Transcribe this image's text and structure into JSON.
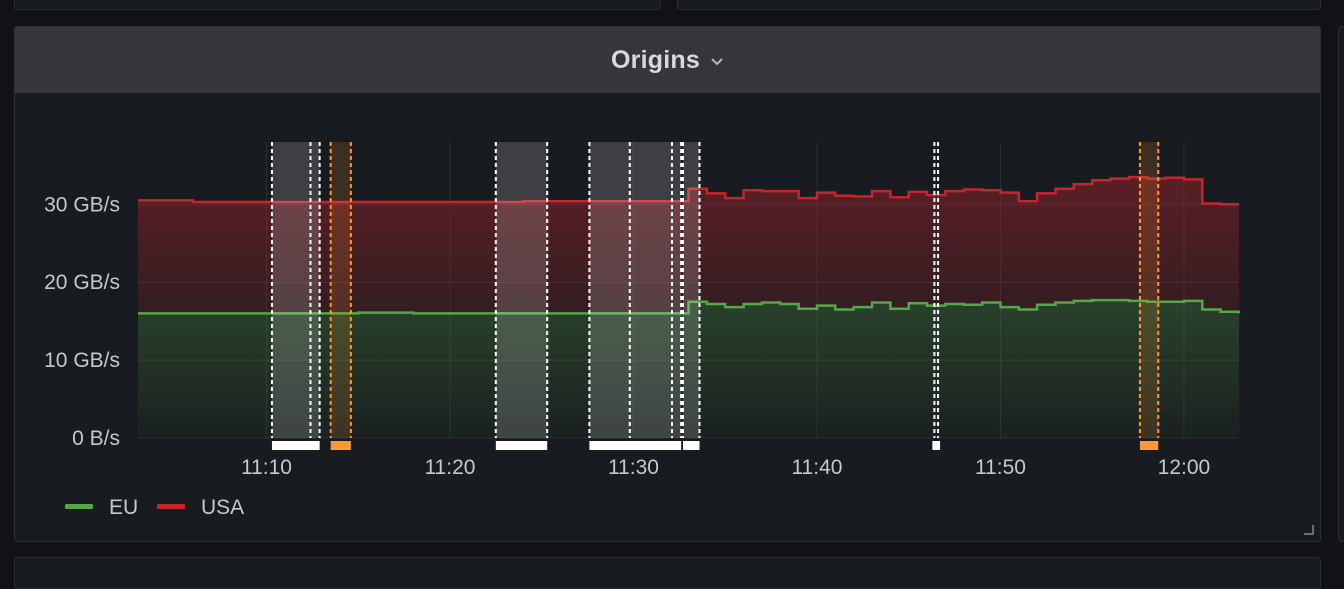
{
  "panel": {
    "title": "Origins"
  },
  "chart_data": {
    "type": "area",
    "stacked": true,
    "ylabel": "",
    "xlabel": "",
    "ylim": [
      0,
      38
    ],
    "y_unit": "GB/s",
    "y_ticks": [
      {
        "value": 0,
        "label": "0 B/s"
      },
      {
        "value": 10,
        "label": "10 GB/s"
      },
      {
        "value": 20,
        "label": "20 GB/s"
      },
      {
        "value": 30,
        "label": "30 GB/s"
      }
    ],
    "x_range": [
      "11:03",
      "12:03"
    ],
    "x_ticks": [
      "11:10",
      "11:20",
      "11:30",
      "11:40",
      "11:50",
      "12:00"
    ],
    "x": [
      "11:03",
      "11:06",
      "11:09",
      "11:12",
      "11:15",
      "11:18",
      "11:21",
      "11:24",
      "11:27",
      "11:30",
      "11:33",
      "11:34",
      "11:35",
      "11:36",
      "11:37",
      "11:38",
      "11:39",
      "11:40",
      "11:41",
      "11:42",
      "11:43",
      "11:44",
      "11:45",
      "11:46",
      "11:47",
      "11:48",
      "11:49",
      "11:50",
      "11:51",
      "11:52",
      "11:53",
      "11:54",
      "11:55",
      "11:56",
      "11:57",
      "11:58",
      "11:59",
      "12:00",
      "12:01",
      "12:02",
      "12:03"
    ],
    "series": [
      {
        "name": "EU",
        "color": "#56a64b",
        "values": [
          16.0,
          16.0,
          16.0,
          16.0,
          16.1,
          16.0,
          16.0,
          16.0,
          16.0,
          16.0,
          17.5,
          17.2,
          16.8,
          17.2,
          17.4,
          17.2,
          16.6,
          17.0,
          16.5,
          16.8,
          17.4,
          16.6,
          17.3,
          17.0,
          17.2,
          17.1,
          17.4,
          16.8,
          16.5,
          17.1,
          17.4,
          17.6,
          17.7,
          17.7,
          17.6,
          17.5,
          17.5,
          17.6,
          16.5,
          16.2,
          16.0
        ]
      },
      {
        "name": "USA",
        "color": "#c4262e",
        "values": [
          14.5,
          14.3,
          14.3,
          14.3,
          14.2,
          14.3,
          14.3,
          14.4,
          14.4,
          14.4,
          14.5,
          14.2,
          14.0,
          14.6,
          14.3,
          14.5,
          14.2,
          14.5,
          14.6,
          14.2,
          14.3,
          14.3,
          14.3,
          14.2,
          14.5,
          14.8,
          14.4,
          14.7,
          13.9,
          14.3,
          14.6,
          15.0,
          15.4,
          15.6,
          15.9,
          15.8,
          15.9,
          15.6,
          13.6,
          13.8,
          14.0
        ]
      }
    ],
    "annotations": [
      {
        "type": "region",
        "start": "11:10.3",
        "end": "11:12.9",
        "color": "#ffffff"
      },
      {
        "type": "line",
        "time": "11:12.4",
        "color": "#ffffff"
      },
      {
        "type": "region",
        "start": "11:13.5",
        "end": "11:14.6",
        "color": "#ff9830"
      },
      {
        "type": "region",
        "start": "11:22.5",
        "end": "11:25.3",
        "color": "#ffffff"
      },
      {
        "type": "region",
        "start": "11:27.6",
        "end": "11:32.6",
        "color": "#ffffff"
      },
      {
        "type": "line",
        "time": "11:29.8",
        "color": "#ffffff"
      },
      {
        "type": "line",
        "time": "11:32.1",
        "color": "#ffffff"
      },
      {
        "type": "region",
        "start": "11:32.7",
        "end": "11:33.6",
        "color": "#ffffff"
      },
      {
        "type": "line",
        "time": "11:46.4",
        "color": "#ffffff"
      },
      {
        "type": "line",
        "time": "11:46.6",
        "color": "#ffffff"
      },
      {
        "type": "region",
        "start": "11:57.6",
        "end": "11:58.6",
        "color": "#ff9830"
      }
    ],
    "legend": "bottom-left"
  },
  "legend_items": [
    {
      "label": "EU",
      "color": "#56a64b"
    },
    {
      "label": "USA",
      "color": "#c4262e"
    }
  ],
  "icons": {
    "title_dropdown": "chevron-down-icon",
    "resize": "resize-handle-icon"
  }
}
